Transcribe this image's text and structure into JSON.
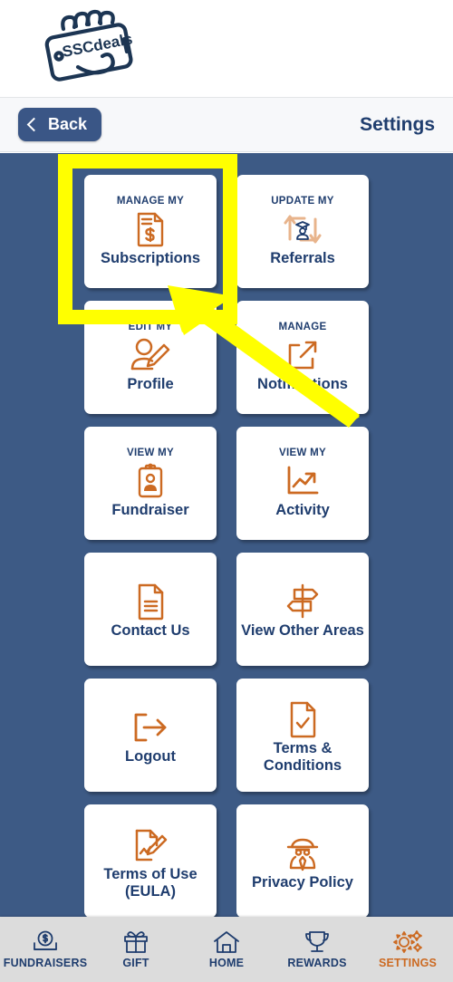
{
  "app": {
    "logo_text": "SSCdeals",
    "logo_icon": "hand-holding-phone-logo"
  },
  "header": {
    "back_label": "Back",
    "back_icon": "chevron-left-icon",
    "title": "Settings"
  },
  "colors": {
    "background": "#3d5a85",
    "navy": "#1f3d6e",
    "orange": "#cc6a22",
    "orange_light": "#e8b48c",
    "tile_bg": "#ffffff",
    "navbar_bg": "#dcdcdc",
    "highlight_yellow": "#ffff00"
  },
  "grid": {
    "tiles": [
      {
        "eyebrow": "MANAGE MY",
        "label": "Subscriptions",
        "icon": "invoice-dollar-icon",
        "highlighted": true
      },
      {
        "eyebrow": "UPDATE MY",
        "label": "Referrals",
        "icon": "referral-cycle-graduate-icon",
        "highlighted": false
      },
      {
        "eyebrow": "EDIT MY",
        "label": "Profile",
        "icon": "user-edit-pencil-icon",
        "highlighted": false
      },
      {
        "eyebrow": "MANAGE",
        "label": "Notifications",
        "icon": "external-arrow-icon",
        "highlighted": false
      },
      {
        "eyebrow": "VIEW MY",
        "label": "Fundraiser",
        "icon": "clipboard-person-icon",
        "highlighted": false
      },
      {
        "eyebrow": "VIEW MY",
        "label": "Activity",
        "icon": "chart-trend-up-icon",
        "highlighted": false
      },
      {
        "eyebrow": "",
        "label": "Contact Us",
        "icon": "document-lines-icon",
        "highlighted": false
      },
      {
        "eyebrow": "",
        "label": "View Other Areas",
        "icon": "signpost-icon",
        "highlighted": false
      },
      {
        "eyebrow": "",
        "label": "Logout",
        "icon": "logout-arrow-icon",
        "highlighted": false
      },
      {
        "eyebrow": "",
        "label": "Terms & Conditions",
        "icon": "document-check-icon",
        "highlighted": false
      },
      {
        "eyebrow": "",
        "label": "Terms of Use (EULA)",
        "icon": "document-signature-icon",
        "highlighted": false
      },
      {
        "eyebrow": "",
        "label": "Privacy Policy",
        "icon": "spy-detective-icon",
        "highlighted": false
      }
    ]
  },
  "annotation": {
    "highlight_target": "Subscriptions",
    "arrow_icon": "yellow-pointer-arrow",
    "box_icon": "yellow-highlight-box"
  },
  "navbar": {
    "items": [
      {
        "label": "FUNDRAISERS",
        "icon": "money-coin-icon",
        "active": false
      },
      {
        "label": "GIFT",
        "icon": "gift-box-icon",
        "active": false
      },
      {
        "label": "HOME",
        "icon": "home-icon",
        "active": false
      },
      {
        "label": "REWARDS",
        "icon": "trophy-icon",
        "active": false
      },
      {
        "label": "SETTINGS",
        "icon": "gears-icon",
        "active": true
      }
    ]
  }
}
